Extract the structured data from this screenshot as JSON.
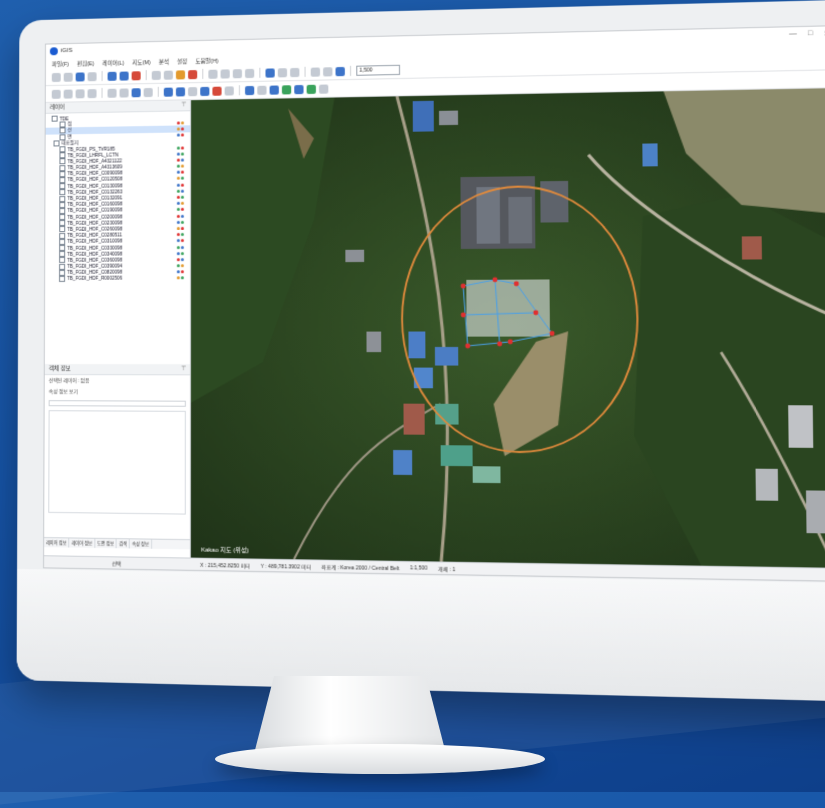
{
  "app": {
    "title": "iGIS"
  },
  "menu": [
    "파일(F)",
    "편집(E)",
    "레이어(L)",
    "지도(M)",
    "분석",
    "설정",
    "도움말(H)"
  ],
  "toolbar": {
    "scale_value": "1,500"
  },
  "window_controls": [
    "—",
    "□",
    "✕"
  ],
  "layer_panel": {
    "title": "레이어",
    "groups": [
      "TDE",
      "점",
      "선",
      "면",
      "대표필지"
    ],
    "layers": [
      "TB_FGDI_PS_TVR185",
      "TB_FGDI_LHRFL_LCTN",
      "TB_FGDI_HDF_A4321122",
      "TB_FGDI_HDF_A4313609",
      "TB_FGDI_HDF_C0090098",
      "TB_FGDI_HDF_C0120508",
      "TB_FGDI_HDF_C0130098",
      "TB_FGDI_HDF_C0132263",
      "TB_FGDI_HDF_C0132091",
      "TB_FGDI_HDF_C0160098",
      "TB_FGDI_HDF_C0190098",
      "TB_FGDI_HDF_C0200098",
      "TB_FGDI_HDF_C0230098",
      "TB_FGDI_HDF_C0260098",
      "TB_FGDI_HDF_C0280511",
      "TB_FGDI_HDF_C0310098",
      "TB_FGDI_HDF_C0330098",
      "TB_FGDI_HDF_C0340098",
      "TB_FGDI_HDF_C0360098",
      "TB_FGDI_HDF_C0390094",
      "TB_FGDI_HDF_C0820098",
      "TB_FGDI_HDF_R0002506"
    ]
  },
  "props_panel": {
    "title": "객체 정보",
    "row1": "선택된 레이어 : 없음",
    "row2": "속성 정보 보기"
  },
  "bottom_tabs": [
    "레이어 정보",
    "레이어 정보",
    "도면 정보",
    "검색",
    "속성 정보"
  ],
  "map": {
    "credit": "Kakao 지도 (위성)"
  },
  "status": {
    "mode": "선택",
    "x": "X : 215,452.8250 미터",
    "y": "Y : 489,781.3902 미터",
    "crs": "좌표계 : Korea 2000 / Central Belt",
    "zoom": "1:1,500",
    "count": "개체 : 1"
  },
  "colors": {
    "accent": "#1a5bd1",
    "polygon_stroke": "#e08a3c",
    "vertex": "#e03030"
  }
}
